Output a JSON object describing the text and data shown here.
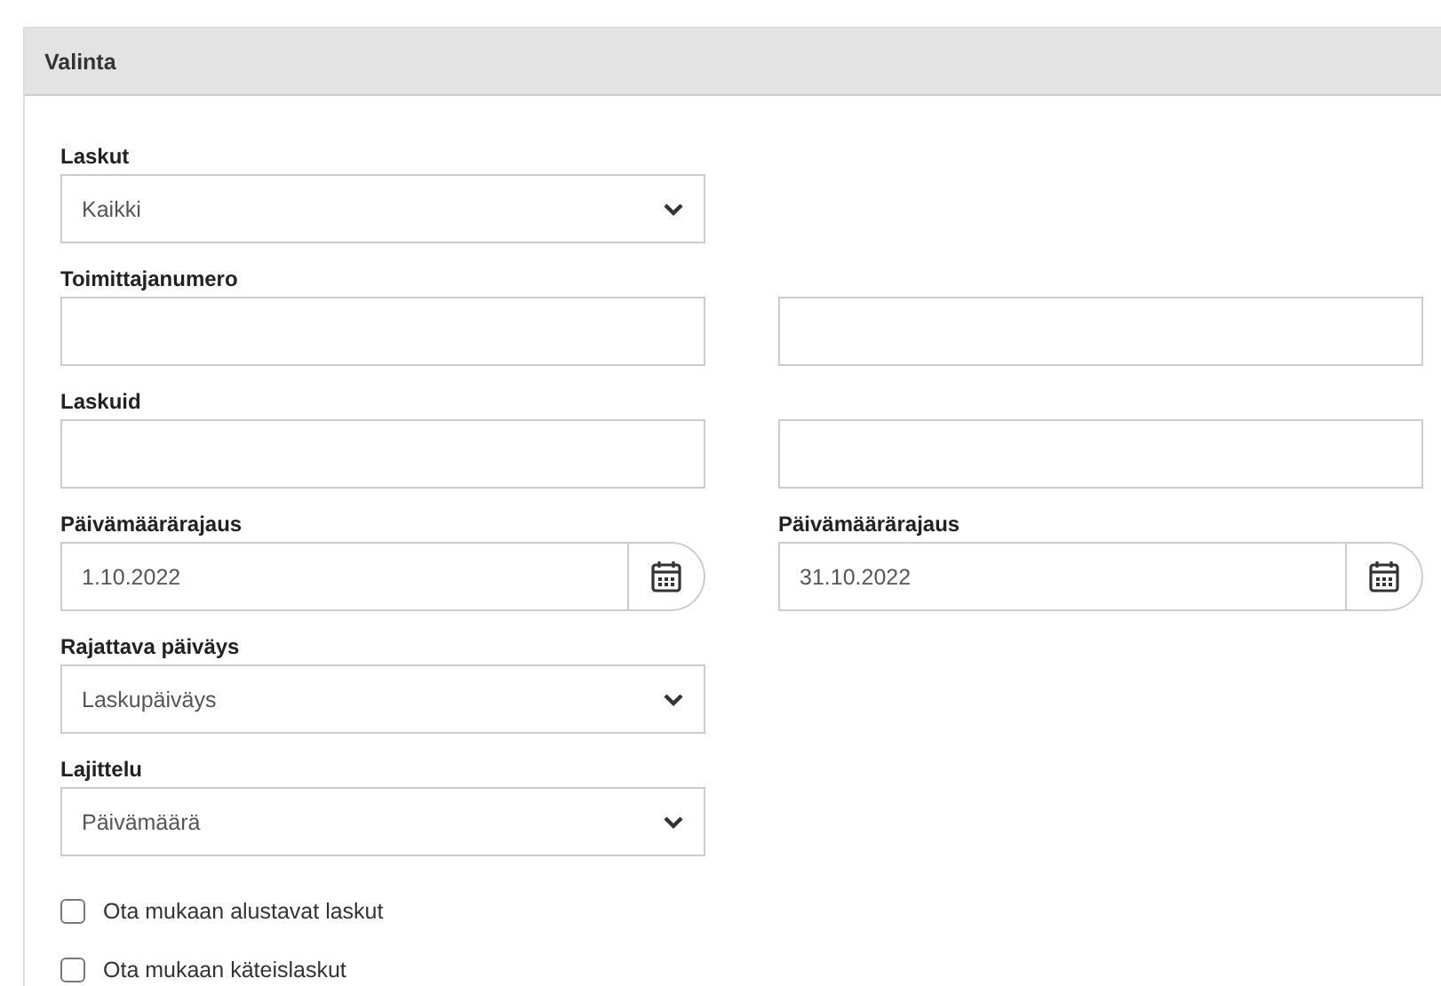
{
  "panel": {
    "title": "Valinta"
  },
  "rows": [
    {
      "columns": [
        {
          "label": "Laskut",
          "kind": "select",
          "value": "Kaikki"
        }
      ]
    },
    {
      "columns": [
        {
          "label": "Toimittajanumero",
          "kind": "text"
        },
        {
          "kind": "text"
        }
      ]
    },
    {
      "columns": [
        {
          "label": "Laskuid",
          "kind": "text"
        },
        {
          "kind": "text"
        }
      ]
    },
    {
      "columns": [
        {
          "label": "Päivämäärärajaus",
          "kind": "date",
          "value": "1.10.2022"
        },
        {
          "label": "Päivämäärärajaus",
          "kind": "date",
          "value": "31.10.2022"
        }
      ]
    },
    {
      "columns": [
        {
          "label": "Rajattava päiväys",
          "kind": "select",
          "value": "Laskupäiväys"
        }
      ]
    },
    {
      "columns": [
        {
          "label": "Lajittelu",
          "kind": "select",
          "value": "Päivämäärä"
        }
      ]
    }
  ],
  "checkboxes": [
    {
      "label": "Ota mukaan alustavat laskut",
      "checked": false
    },
    {
      "label": "Ota mukaan käteislaskut",
      "checked": false
    }
  ]
}
